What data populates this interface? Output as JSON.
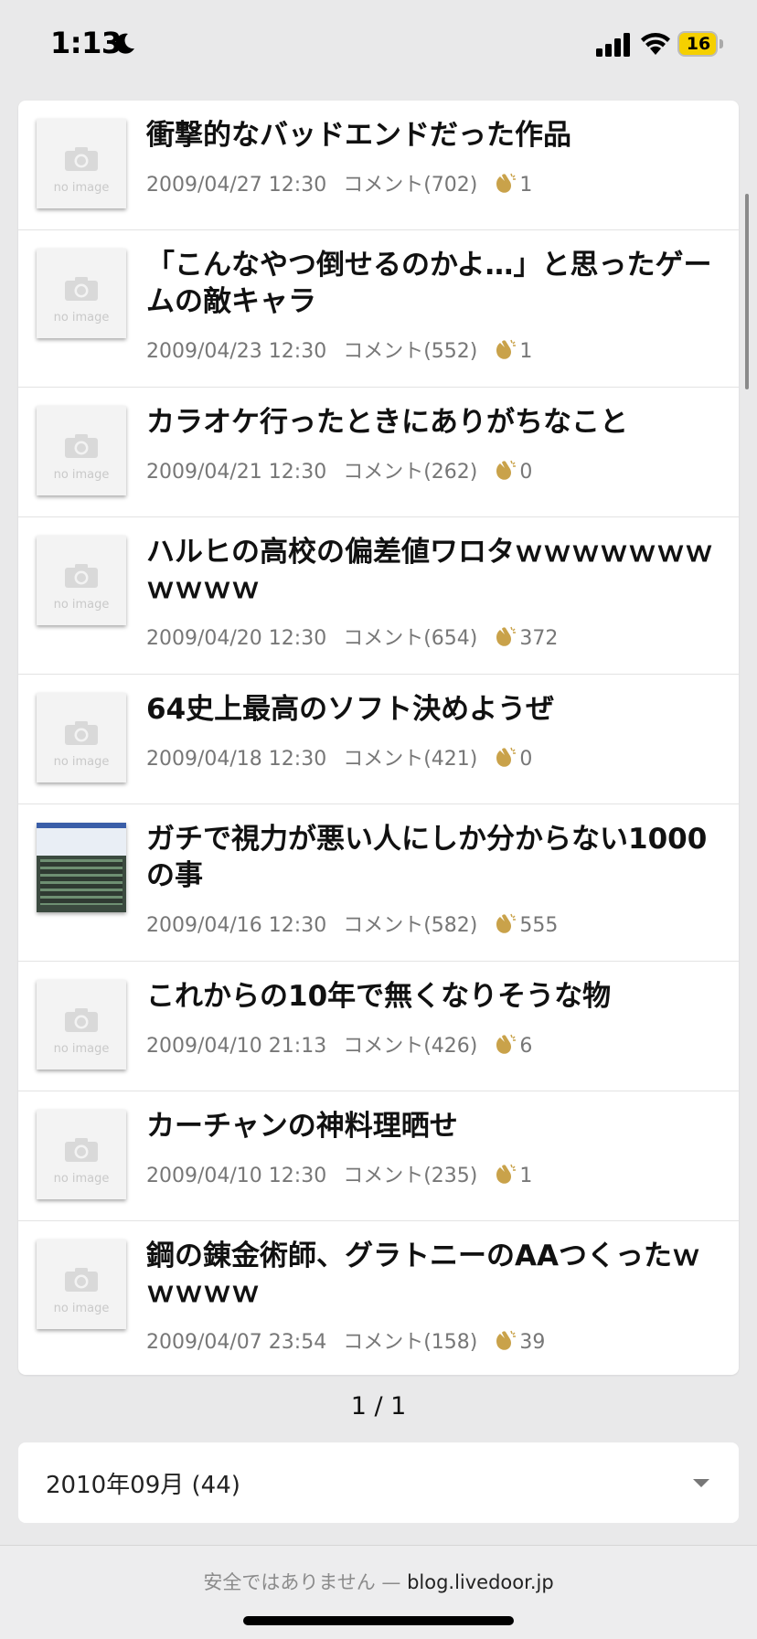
{
  "status_bar": {
    "time": "1:13",
    "battery": "16"
  },
  "posts": [
    {
      "title": "衝撃的なバッドエンドだった作品",
      "date": "2009/04/27 12:30",
      "comments": "コメント(702)",
      "claps": "1",
      "thumb": "no image"
    },
    {
      "title": "「こんなやつ倒せるのかよ…」と思ったゲームの敵キャラ",
      "date": "2009/04/23 12:30",
      "comments": "コメント(552)",
      "claps": "1",
      "thumb": "no image"
    },
    {
      "title": "カラオケ行ったときにありがちなこと",
      "date": "2009/04/21 12:30",
      "comments": "コメント(262)",
      "claps": "0",
      "thumb": "no image"
    },
    {
      "title": "ハルヒの高校の偏差値ワロタｗｗｗｗｗｗｗｗｗｗｗ",
      "date": "2009/04/20 12:30",
      "comments": "コメント(654)",
      "claps": "372",
      "thumb": "no image"
    },
    {
      "title": "64史上最高のソフト決めようぜ",
      "date": "2009/04/18 12:30",
      "comments": "コメント(421)",
      "claps": "0",
      "thumb": "no image"
    },
    {
      "title": "ガチで視力が悪い人にしか分からない1000の事",
      "date": "2009/04/16 12:30",
      "comments": "コメント(582)",
      "claps": "555",
      "thumb": ""
    },
    {
      "title": "これからの10年で無くなりそうな物",
      "date": "2009/04/10 21:13",
      "comments": "コメント(426)",
      "claps": "6",
      "thumb": "no image"
    },
    {
      "title": "カーチャンの神料理晒せ",
      "date": "2009/04/10 12:30",
      "comments": "コメント(235)",
      "claps": "1",
      "thumb": "no image"
    },
    {
      "title": "鋼の錬金術師、グラトニーのAAつくったｗｗｗｗｗ",
      "date": "2009/04/07 23:54",
      "comments": "コメント(158)",
      "claps": "39",
      "thumb": "no image"
    }
  ],
  "pagination": "1 / 1",
  "archive_select": {
    "value": "2010年09月 (44)"
  },
  "browser_bar": {
    "warning": "安全ではありません — ",
    "host": "blog.livedoor.jp"
  },
  "colors": {
    "clap": "#c9a24a",
    "background": "#e9e9ea"
  }
}
